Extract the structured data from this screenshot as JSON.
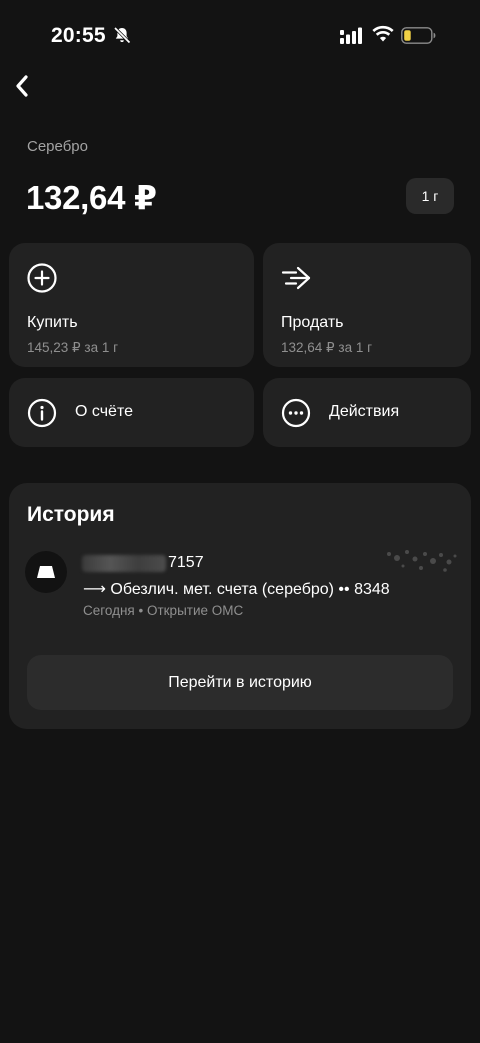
{
  "status_bar": {
    "time": "20:55",
    "icons": [
      "bell-muted-icon",
      "cellular-signal-icon",
      "wifi-icon",
      "battery-low-icon"
    ]
  },
  "nav": {
    "back_icon": "chevron-left-icon"
  },
  "asset": {
    "name": "Серебро",
    "price": "132,64 ₽",
    "unit": "1 г"
  },
  "actions": {
    "buy": {
      "icon": "plus-circle-icon",
      "label": "Купить",
      "subtitle": "145,23 ₽ за 1 г"
    },
    "sell": {
      "icon": "arrow-right-fast-icon",
      "label": "Продать",
      "subtitle": "132,64 ₽ за 1 г"
    },
    "about": {
      "icon": "info-circle-icon",
      "label": "О счёте"
    },
    "more": {
      "icon": "more-circle-icon",
      "label": "Действия"
    }
  },
  "history": {
    "title": "История",
    "operations": [
      {
        "from_suffix": "7157",
        "arrow": "⟶",
        "to": "Обезлич. мет. счета (серебро) •• 8348",
        "meta": "Сегодня • Открытие ОМС"
      }
    ],
    "go_button": "Перейти в историю"
  },
  "colors": {
    "background": "#131313",
    "card": "#222222",
    "secondary_text": "#8f8f8f",
    "battery_fill": "#f2d245"
  }
}
